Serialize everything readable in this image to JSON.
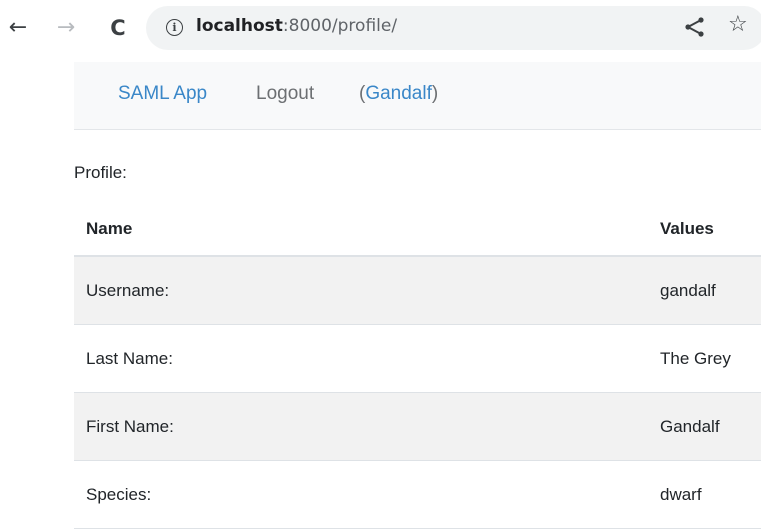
{
  "browser": {
    "back_icon": "←",
    "forward_icon": "→",
    "reload_icon": "C",
    "info_icon": "i",
    "url_host": "localhost",
    "url_rest": ":8000/profile/",
    "star_icon": "☆"
  },
  "navbar": {
    "brand": "SAML App",
    "logout": "Logout",
    "user_open": "(",
    "user_name": "Gandalf",
    "user_close": ")"
  },
  "main": {
    "profile_label": "Profile:",
    "table": {
      "headers": [
        "Name",
        "Values"
      ],
      "rows": [
        {
          "name": "Username:",
          "value": "gandalf"
        },
        {
          "name": "Last Name:",
          "value": "The Grey"
        },
        {
          "name": "First Name:",
          "value": "Gandalf"
        },
        {
          "name": "Species:",
          "value": "dwarf"
        }
      ]
    }
  },
  "colors": {
    "link": "#3a87c8",
    "navbar_bg": "#f8f9fa",
    "row_stripe": "#f2f2f2"
  }
}
